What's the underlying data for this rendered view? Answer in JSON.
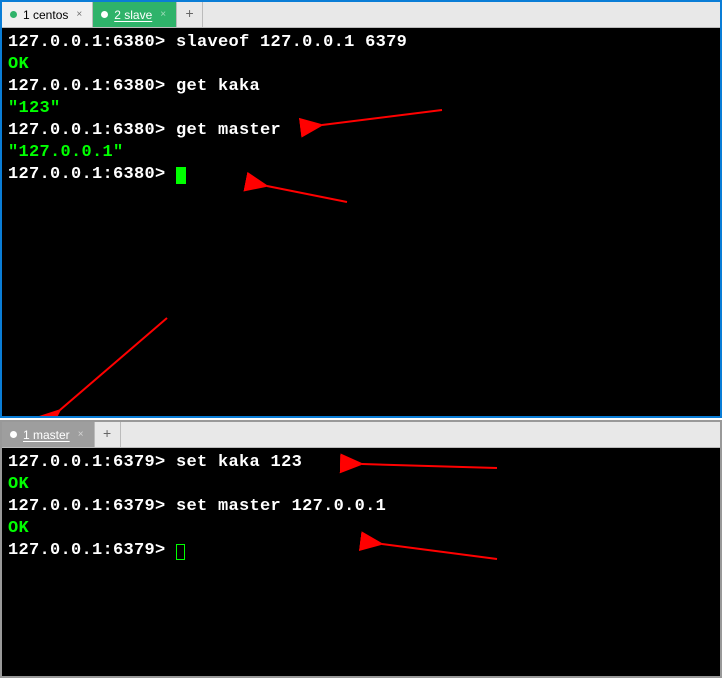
{
  "top": {
    "tabs": [
      {
        "label": "1 centos",
        "active": false
      },
      {
        "label": "2 slave",
        "active": true
      }
    ],
    "terminal": {
      "lines": [
        {
          "prompt": "127.0.0.1:6380>",
          "cmd": "slaveof 127.0.0.1 6379"
        },
        {
          "out": "OK"
        },
        {
          "prompt": "127.0.0.1:6380>",
          "cmd": "get kaka"
        },
        {
          "out": "\"123\""
        },
        {
          "prompt": "127.0.0.1:6380>",
          "cmd": "get master"
        },
        {
          "out": "\"127.0.0.1\""
        },
        {
          "prompt": "127.0.0.1:6380>",
          "cursor": "solid"
        }
      ]
    }
  },
  "bottom": {
    "tabs": [
      {
        "label": "1 master",
        "active": true
      }
    ],
    "terminal": {
      "lines": [
        {
          "prompt": "127.0.0.1:6379>",
          "cmd": "set kaka 123"
        },
        {
          "out": "OK"
        },
        {
          "prompt": "127.0.0.1:6379>",
          "cmd": "set master 127.0.0.1"
        },
        {
          "out": "OK"
        },
        {
          "prompt": "127.0.0.1:6379>",
          "cursor": "outline"
        }
      ]
    }
  },
  "glyphs": {
    "close": "×",
    "plus": "+"
  }
}
